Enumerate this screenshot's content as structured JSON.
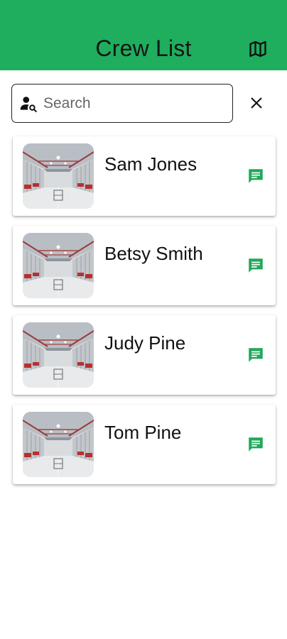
{
  "header": {
    "title": "Crew List",
    "map_icon": "map-icon",
    "background_color": "#1fad5e"
  },
  "search": {
    "placeholder": "Search",
    "value": "",
    "leading_icon": "person-search-icon",
    "clear_icon": "close-icon"
  },
  "crew": [
    {
      "name": "Sam Jones",
      "photo": "warehouse-photo",
      "action_icon": "message-icon"
    },
    {
      "name": "Betsy Smith",
      "photo": "warehouse-photo",
      "action_icon": "message-icon"
    },
    {
      "name": "Judy Pine",
      "photo": "warehouse-photo",
      "action_icon": "message-icon"
    },
    {
      "name": "Tom Pine",
      "photo": "warehouse-photo",
      "action_icon": "message-icon"
    }
  ],
  "colors": {
    "accent": "#1fad5e",
    "message_icon": "#21a85a"
  }
}
